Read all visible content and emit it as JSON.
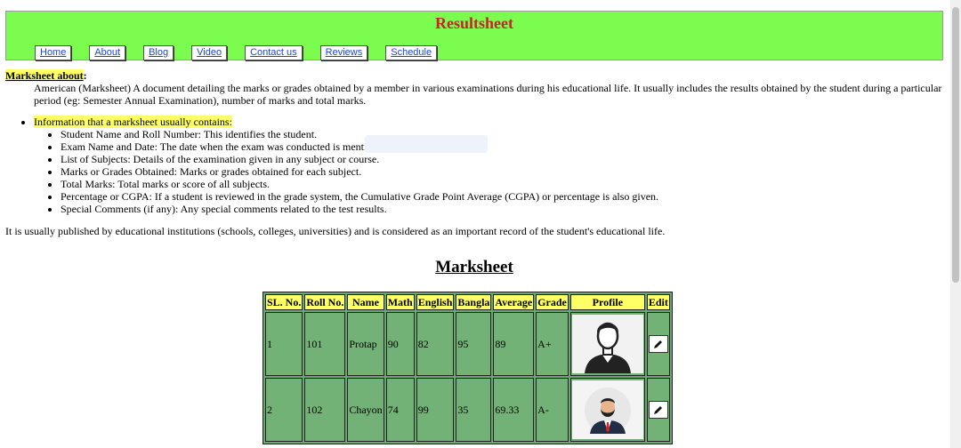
{
  "site": {
    "title": "Resultsheet"
  },
  "nav": [
    "Home",
    "About",
    "Blog",
    "Video",
    "Contact us",
    "Reviews",
    "Schedule"
  ],
  "about": {
    "title": "Marksheet about",
    "paragraph": "American (Marksheet) A document detailing the marks or grades obtained by a member in various examinations during his educational life. It usually includes the results obtained by the student during a particular period (eg: Semester Annual Examination), number of marks and total marks."
  },
  "info": {
    "title": "Information that a marksheet usually contains:",
    "points": [
      "Student Name and Roll Number: This identifies the student.",
      "Exam Name and Date: The date when the exam was conducted is mentioned.",
      "List of Subjects: Details of the examination given in any subject or course.",
      "Marks or Grades Obtained: Marks or grades obtained for each subject.",
      "Total Marks: Total marks or score of all subjects.",
      "Percentage or CGPA: If a student is reviewed in the grade system, the Cumulative Grade Point Average (CGPA) or percentage is also given.",
      "Special Comments (if any): Any special comments related to the test results."
    ]
  },
  "closing": "It is usually published by educational institutions (schools, colleges, universities) and is considered as an important record of the student's educational life.",
  "marksheet": {
    "title": "Marksheet",
    "headers": [
      "SL. No.",
      "Roll No.",
      "Name",
      "Math",
      "English",
      "Bangla",
      "Average",
      "Grade",
      "Profile",
      "Edit"
    ],
    "rows": [
      {
        "sl": "1",
        "roll": "101",
        "name": "Protap",
        "math": "90",
        "english": "82",
        "bangla": "95",
        "average": "89",
        "grade": "A+",
        "profile": "male-avatar-icon"
      },
      {
        "sl": "2",
        "roll": "102",
        "name": "Chayon",
        "math": "74",
        "english": "99",
        "bangla": "35",
        "average": "69.33",
        "grade": "A-",
        "profile": "bearded-man-avatar-icon"
      }
    ],
    "edit_icon": "pencil-icon"
  },
  "colors": {
    "header_bg": "#7cfc4f",
    "title": "#c0262a",
    "highlight": "#ffff66",
    "table_bg": "#72b276"
  }
}
